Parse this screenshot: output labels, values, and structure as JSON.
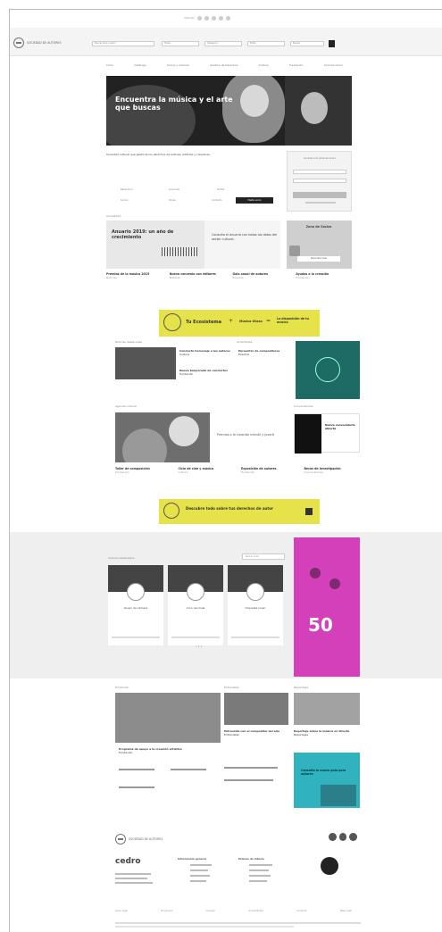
{
  "topbar": {
    "lang": "Idiomas"
  },
  "header": {
    "logo_text": "SOCIEDAD DE AUTORES",
    "search": [
      {
        "placeholder": "Buscar obra o autor"
      },
      {
        "placeholder": "Todas"
      },
      {
        "placeholder": "Categoría"
      },
      {
        "placeholder": "Estilo"
      },
      {
        "placeholder": "Buscar"
      }
    ]
  },
  "nav": {
    "items": [
      "Inicio",
      "Catálogo",
      "Socios y Autores",
      "Gestión de Derechos",
      "Cultura",
      "Fundación",
      "Comunicación"
    ]
  },
  "hero": {
    "title": "Encuentra la música y el arte que buscas"
  },
  "intro": {
    "text": "Sociedad cultural que gestiona los derechos de autores, editores y creadores."
  },
  "signin": {
    "title": "Accede a tu área de socio",
    "button": "Acceder",
    "link": "¿Olvidaste tu contraseña?"
  },
  "quick": {
    "items": [
      "Repertorio",
      "Licencias",
      "Tarifas",
      "Socios",
      "Obras",
      "Contacto"
    ],
    "cta": "Hazte socio"
  },
  "feature": {
    "section": "Actualidad",
    "title": "Anuario 2019: un año de crecimiento",
    "text": "Consulta el anuario con todos los datos del sector cultural."
  },
  "promo": {
    "title": "Zona de Socios",
    "button": "Descubre más"
  },
  "cards": [
    {
      "h": "Premios de la música 2019",
      "sub": "Noticias"
    },
    {
      "h": "Nuevo convenio con editores",
      "sub": "Noticias"
    },
    {
      "h": "Gala anual de autores",
      "sub": "Eventos"
    },
    {
      "h": "Ayudas a la creación",
      "sub": "Fundación"
    }
  ],
  "yellow1": {
    "a": "Tu Ecosistema",
    "b": "Música Obras",
    "c": "La disposición de tu música"
  },
  "news": {
    "left_label": "Noticias destacadas",
    "right_label": "Actividades",
    "items": [
      {
        "h": "Concierto homenaje a los autores",
        "sub": "Cultura"
      },
      {
        "h": "Nueva temporada de conciertos",
        "sub": "Fundación"
      },
      {
        "h": "Encuentro de compositores",
        "sub": "Eventos"
      }
    ]
  },
  "row2": {
    "label": "Agenda cultural",
    "right_label": "Convocatorias",
    "text": "Premios a la creación infantil y juvenil",
    "dark_title": "Nueva convocatoria abierta",
    "cards": [
      {
        "h": "Taller de composición",
        "sub": "Formación"
      },
      {
        "h": "Ciclo de cine y música",
        "sub": "Cultura"
      },
      {
        "h": "Exposición de autores",
        "sub": "Fundación"
      },
      {
        "h": "Becas de investigación",
        "sub": "Convocatorias"
      }
    ]
  },
  "yellow2": {
    "text": "Descubre todo sobre tus derechos de autor"
  },
  "band": {
    "label": "Autores destacados",
    "search": "Buscar autor",
    "cards": [
      "Grupo de cámara",
      "Coro nacional",
      "Orquesta joven"
    ],
    "dots": "• • •",
    "magenta_number": "50"
  },
  "lower": {
    "label1": "Fundación",
    "label2": "Entrevistas",
    "label3": "Reportajes",
    "items": [
      {
        "h": "Programa de apoyo a la creación artística",
        "sub": "Fundación"
      },
      {
        "h": "Entrevista con el compositor del año",
        "sub": "Entrevistas"
      },
      {
        "h": "Reportaje sobre la música en directo",
        "sub": "Reportajes"
      }
    ],
    "cyan_text": "Consulta la nueva guía para autores"
  },
  "footer": {
    "logo_text": "SOCIEDAD DE AUTORES",
    "cedro": "cedro",
    "col1": "Información general",
    "col2": "Enlaces de interés",
    "links": [
      "Aviso legal",
      "Privacidad",
      "Cookies",
      "Accesibilidad",
      "Contacto",
      "Mapa web"
    ]
  },
  "colors": {
    "yellow": "#e6e34a",
    "teal": "#1d6b64",
    "magenta": "#d43fba",
    "cyan": "#31b3bf"
  }
}
